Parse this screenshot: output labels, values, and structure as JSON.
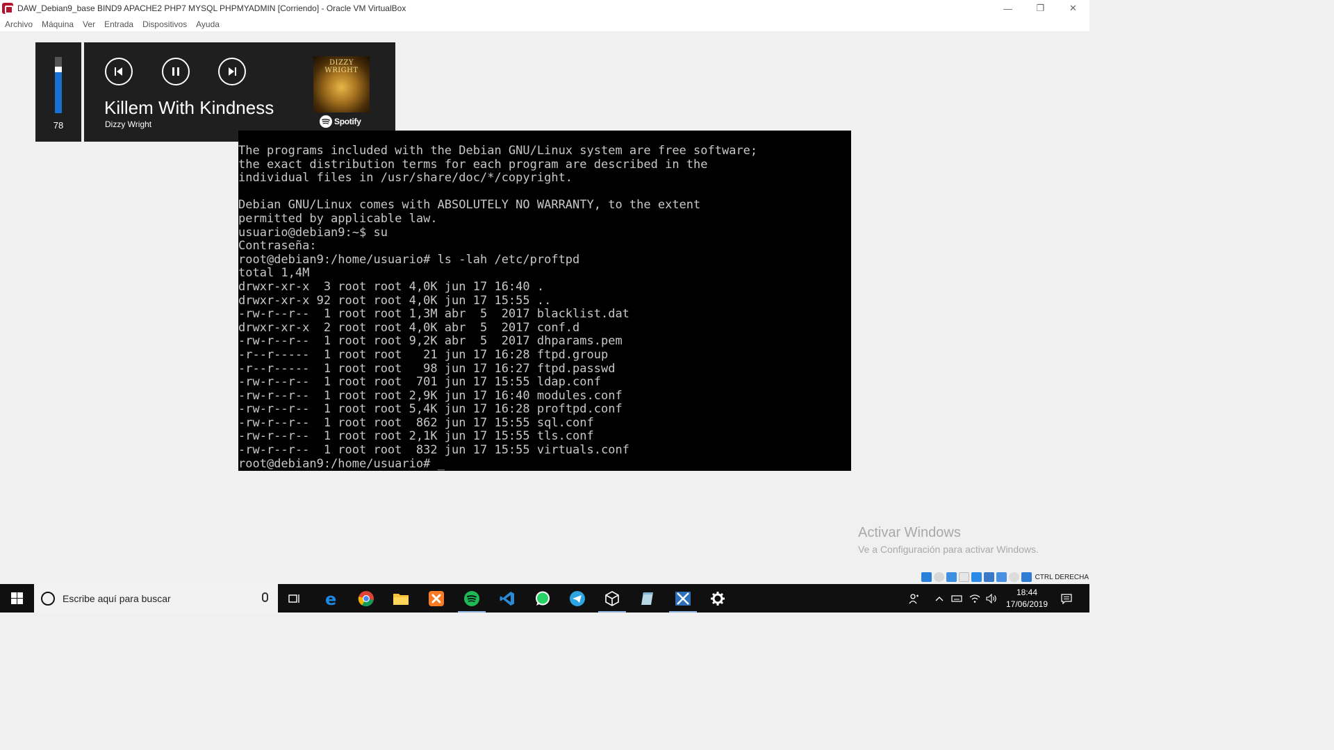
{
  "window": {
    "title": "DAW_Debian9_base BIND9 APACHE2 PHP7 MYSQL PHPMYADMIN [Corriendo] - Oracle VM VirtualBox",
    "controls": {
      "minimize": "—",
      "restore": "❐",
      "close": "✕"
    }
  },
  "menubar": {
    "items": [
      "Archivo",
      "Máquina",
      "Ver",
      "Entrada",
      "Dispositivos",
      "Ayuda"
    ]
  },
  "volume": {
    "level": 78,
    "level_label": "78"
  },
  "media": {
    "track_title": "Killem With Kindness",
    "artist": "Dizzy Wright",
    "album_art_text": "DIZZY WRIGHT",
    "source_label": "Spotify",
    "buttons": {
      "previous": "previous",
      "pause": "pause",
      "next": "next"
    }
  },
  "terminal": {
    "lines": [
      "The programs included with the Debian GNU/Linux system are free software;",
      "the exact distribution terms for each program are described in the",
      "individual files in /usr/share/doc/*/copyright.",
      "",
      "Debian GNU/Linux comes with ABSOLUTELY NO WARRANTY, to the extent",
      "permitted by applicable law.",
      "usuario@debian9:~$ su",
      "Contraseña:",
      "root@debian9:/home/usuario# ls -lah /etc/proftpd",
      "total 1,4M",
      "drwxr-xr-x  3 root root 4,0K jun 17 16:40 .",
      "drwxr-xr-x 92 root root 4,0K jun 17 15:55 ..",
      "-rw-r--r--  1 root root 1,3M abr  5  2017 blacklist.dat",
      "drwxr-xr-x  2 root root 4,0K abr  5  2017 conf.d",
      "-rw-r--r--  1 root root 9,2K abr  5  2017 dhparams.pem",
      "-r--r-----  1 root root   21 jun 17 16:28 ftpd.group",
      "-r--r-----  1 root root   98 jun 17 16:27 ftpd.passwd",
      "-rw-r--r--  1 root root  701 jun 17 15:55 ldap.conf",
      "-rw-r--r--  1 root root 2,9K jun 17 16:40 modules.conf",
      "-rw-r--r--  1 root root 5,4K jun 17 16:28 proftpd.conf",
      "-rw-r--r--  1 root root  862 jun 17 15:55 sql.conf",
      "-rw-r--r--  1 root root 2,1K jun 17 15:55 tls.conf",
      "-rw-r--r--  1 root root  832 jun 17 15:55 virtuals.conf",
      "root@debian9:/home/usuario# _"
    ]
  },
  "watermark": {
    "title": "Activar Windows",
    "subtitle": "Ve a Configuración para activar Windows."
  },
  "vbox_status": {
    "icons": [
      "optical-drive-icon",
      "audio-icon",
      "network-icon",
      "usb-icon",
      "shared-folders-icon",
      "display-icon",
      "video-capture-icon",
      "vt-x-icon",
      "mouse-integration-icon",
      "keyboard-capture-icon"
    ],
    "host_key_label": "CTRL DERECHA"
  },
  "taskbar": {
    "search_placeholder": "Escribe aquí para buscar",
    "apps": [
      "task-view",
      "edge",
      "chrome",
      "file-explorer",
      "xampp",
      "spotify",
      "vscode",
      "whatsapp",
      "telegram",
      "virtualbox",
      "notepad",
      "xming",
      "settings"
    ],
    "clock": {
      "time": "18:44",
      "date": "17/06/2019"
    }
  },
  "colors": {
    "accent_blue": "#1a6fd4",
    "spotify_green": "#1db954",
    "terminal_text": "#c8c8c8",
    "brand_red": "#b5122e"
  }
}
